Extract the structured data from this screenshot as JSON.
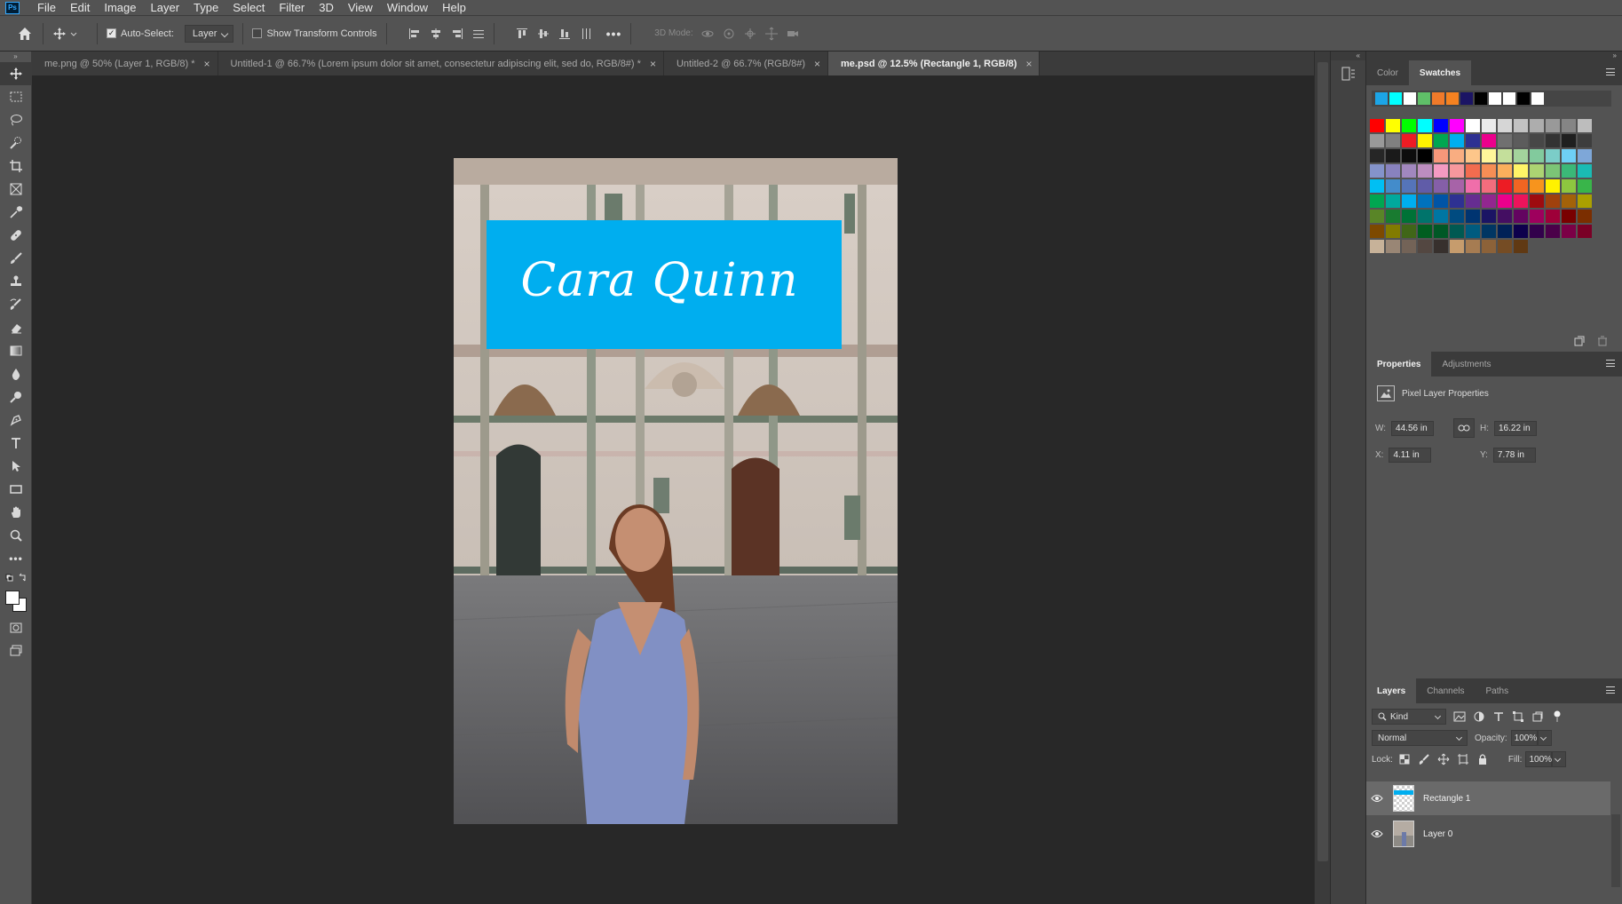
{
  "app": {
    "logo": "Ps"
  },
  "menu": [
    "File",
    "Edit",
    "Image",
    "Layer",
    "Type",
    "Select",
    "Filter",
    "3D",
    "View",
    "Window",
    "Help"
  ],
  "options": {
    "auto_select_label": "Auto-Select:",
    "auto_select_value": "Layer",
    "show_transform_label": "Show Transform Controls",
    "mode_3d_label": "3D Mode:"
  },
  "tabs": [
    {
      "label": "me.png @ 50% (Layer 1, RGB/8) *",
      "active": false
    },
    {
      "label": "Untitled-1 @ 66.7% (Lorem ipsum dolor sit amet, consectetur adipiscing elit, sed do, RGB/8#) *",
      "active": false
    },
    {
      "label": "Untitled-2 @ 66.7% (RGB/8#)",
      "active": false
    },
    {
      "label": "me.psd @ 12.5% (Rectangle 1, RGB/8)",
      "active": true
    }
  ],
  "canvas": {
    "name_text": "Cara Quinn",
    "rect_color": "#00aeef"
  },
  "swatches_panel": {
    "tabs": [
      "Color",
      "Swatches"
    ],
    "active_tab": "Swatches",
    "recent": [
      "#1ca5e6",
      "#00ffff",
      "#ffffff",
      "#5fbf68",
      "#f07a2a",
      "#f58220",
      "#1b1464",
      "#000000",
      "#ffffff",
      "#ffffff",
      "#000000",
      "#ffffff"
    ],
    "grid": [
      "#ff0000",
      "#ffff00",
      "#00ff00",
      "#00ffff",
      "#0000ff",
      "#ff00ff",
      "#ffffff",
      "#ebebeb",
      "#d6d6d6",
      "#c2c2c2",
      "#adadad",
      "#999999",
      "#858585",
      "#bdbdbd",
      "#999999",
      "#808080",
      "#ed1c24",
      "#fff200",
      "#00a651",
      "#00aeef",
      "#2e3192",
      "#ec008c",
      "#707070",
      "#5c5c5c",
      "#474747",
      "#333333",
      "#1f1f1f",
      "#3d3d3d",
      "#262626",
      "#1a1a1a",
      "#0d0d0d",
      "#000000",
      "#f7977a",
      "#f9ad81",
      "#fdc68a",
      "#fff79a",
      "#c4df9b",
      "#a3d39c",
      "#82ca9d",
      "#7bcdc8",
      "#6ecff6",
      "#7ea7d8",
      "#8493ca",
      "#8882be",
      "#a187be",
      "#bc8dbf",
      "#f49ac2",
      "#f6989d",
      "#f26c4f",
      "#f68e55",
      "#fbaf5c",
      "#fff467",
      "#acd372",
      "#7cc576",
      "#3bb878",
      "#1abbb4",
      "#00bff3",
      "#438ccb",
      "#5574b9",
      "#605ca8",
      "#855fa8",
      "#a763a8",
      "#f06eaa",
      "#f26d7d",
      "#ed1c24",
      "#f26522",
      "#f7941d",
      "#fff200",
      "#8dc73f",
      "#39b54a",
      "#00a651",
      "#00a99d",
      "#00aeef",
      "#0072bc",
      "#0054a6",
      "#2e3192",
      "#662d91",
      "#92278f",
      "#ec008c",
      "#ed145b",
      "#9e0b0f",
      "#a0410d",
      "#a36209",
      "#aba000",
      "#598527",
      "#197b30",
      "#007236",
      "#00746b",
      "#0076a3",
      "#004b80",
      "#003471",
      "#1b1464",
      "#440e62",
      "#630460",
      "#9e005d",
      "#9e0039",
      "#790000",
      "#7b2e00",
      "#7d4900",
      "#827b00",
      "#406618",
      "#005e20",
      "#005826",
      "#005952",
      "#005b7f",
      "#003663",
      "#002157",
      "#0d004c",
      "#32004b",
      "#4b0049",
      "#7b0046",
      "#7a0026",
      "#c7b299",
      "#998675",
      "#736357",
      "#534741",
      "#37302d",
      "#c69c6d",
      "#a67c52",
      "#8c6239",
      "#754c24",
      "#603913"
    ]
  },
  "properties_panel": {
    "tabs": [
      "Properties",
      "Adjustments"
    ],
    "active_tab": "Properties",
    "title": "Pixel Layer Properties",
    "w_label": "W:",
    "w_value": "44.56 in",
    "h_label": "H:",
    "h_value": "16.22 in",
    "x_label": "X:",
    "x_value": "4.11 in",
    "y_label": "Y:",
    "y_value": "7.78 in"
  },
  "layers_panel": {
    "tabs": [
      "Layers",
      "Channels",
      "Paths"
    ],
    "active_tab": "Layers",
    "kind_label": "Kind",
    "blend_mode": "Normal",
    "opacity_label": "Opacity:",
    "opacity_value": "100%",
    "lock_label": "Lock:",
    "fill_label": "Fill:",
    "fill_value": "100%",
    "layers": [
      {
        "name": "Rectangle 1",
        "selected": true
      },
      {
        "name": "Layer 0",
        "selected": false
      }
    ]
  }
}
